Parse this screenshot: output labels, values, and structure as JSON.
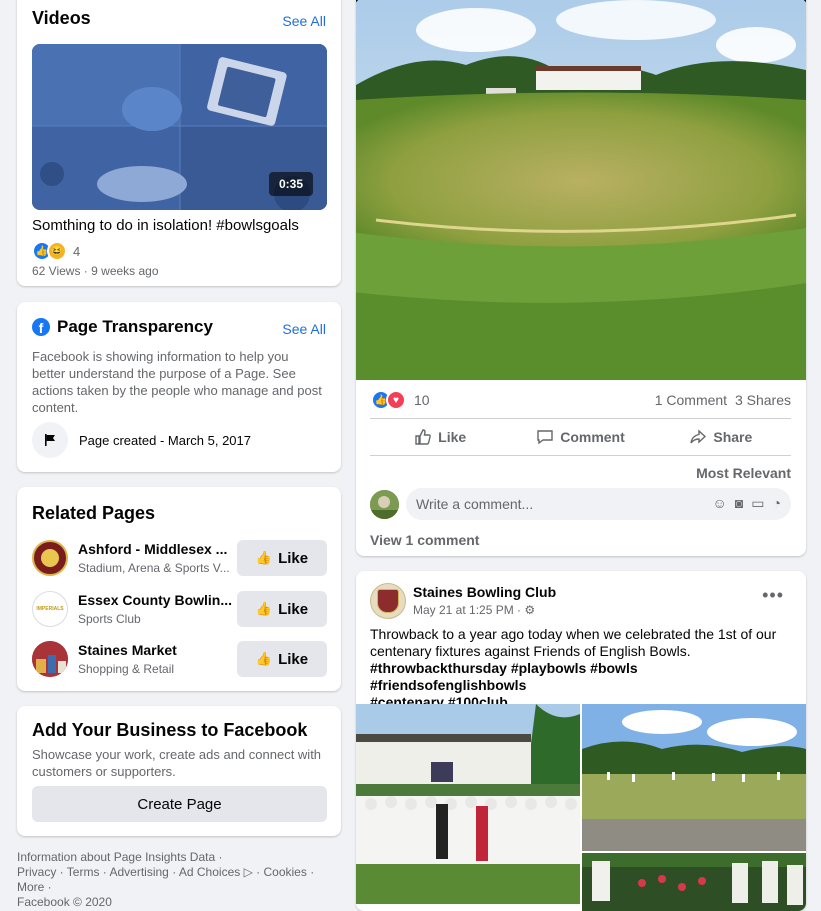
{
  "videos": {
    "title": "Videos",
    "see_all": "See All",
    "duration": "0:35",
    "video_title": "Somthing to do in isolation! #bowlsgoals",
    "reaction_count": "4",
    "meta": "62 Views · 9 weeks ago"
  },
  "transparency": {
    "title": "Page Transparency",
    "see_all": "See All",
    "description": "Facebook is showing information to help you better understand the purpose of a Page. See actions taken by the people who manage and post content.",
    "page_created": "Page created - March 5, 2017"
  },
  "related": {
    "title": "Related Pages",
    "like_label": "Like",
    "items": [
      {
        "name": "Ashford - Middlesex ...",
        "category": "Stadium, Arena & Sports V..."
      },
      {
        "name": "Essex County Bowlin...",
        "category": "Sports Club",
        "logo_text": "IMPERIALS"
      },
      {
        "name": "Staines Market",
        "category": "Shopping & Retail"
      }
    ]
  },
  "business": {
    "title": "Add Your Business to Facebook",
    "description": "Showcase your work, create ads and connect with customers or supporters.",
    "button": "Create Page"
  },
  "footer": {
    "line1": "Information about Page Insights Data ·",
    "privacy": "Privacy",
    "terms": "Terms",
    "advertising": "Advertising",
    "ad_choices": "Ad Choices",
    "cookies": "Cookies",
    "more": "More",
    "copyright": "Facebook © 2020"
  },
  "post1": {
    "reaction_count": "10",
    "comments": "1 Comment",
    "shares": "3 Shares",
    "like": "Like",
    "comment": "Comment",
    "share": "Share",
    "most_relevant": "Most Relevant",
    "comment_placeholder": "Write a comment...",
    "view_comments": "View 1 comment"
  },
  "post2": {
    "author": "Staines Bowling Club",
    "time": "May 21 at 1:25 PM ·",
    "text_line1": "Throwback to a year ago today when we celebrated the 1st of our",
    "text_line2": "centenary fixtures against Friends of English Bowls.",
    "hashtags_line1": "#throwbackthursday #playbowls #bowls #friendsofenglishbowls",
    "hashtags_line2": "#centenary #100club"
  },
  "colors": {
    "accent": "#216fdb",
    "background": "#f0f2f5",
    "like_blue": "#1877f2",
    "love_red": "#f33e58"
  }
}
